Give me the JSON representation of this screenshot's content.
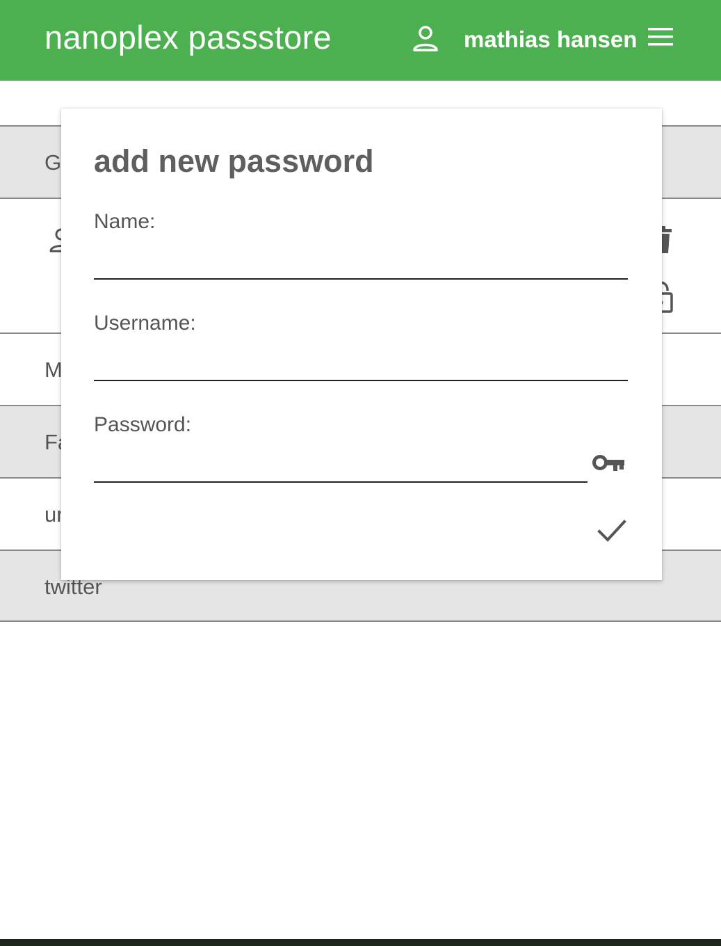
{
  "header": {
    "title": "nanoplex passstore",
    "user_name": "mathias hansen",
    "icons": {
      "user": "person-icon",
      "menu": "hamburger-menu-icon"
    },
    "background_color": "#4caf50"
  },
  "list": {
    "rows": [
      {
        "label": "G"
      },
      {
        "label": ""
      },
      {
        "label": "M"
      },
      {
        "label": "Fa"
      },
      {
        "label": "ur"
      },
      {
        "label": "twitter"
      }
    ],
    "expanded_row_icons": [
      "person-icon",
      "trash-icon",
      "lock-icon"
    ]
  },
  "dialog": {
    "title": "add new password",
    "name_label": "Name:",
    "name_value": "",
    "username_label": "Username:",
    "username_value": "",
    "password_label": "Password:",
    "password_value": "",
    "icons": {
      "generate": "key-icon",
      "confirm": "check-icon"
    }
  }
}
